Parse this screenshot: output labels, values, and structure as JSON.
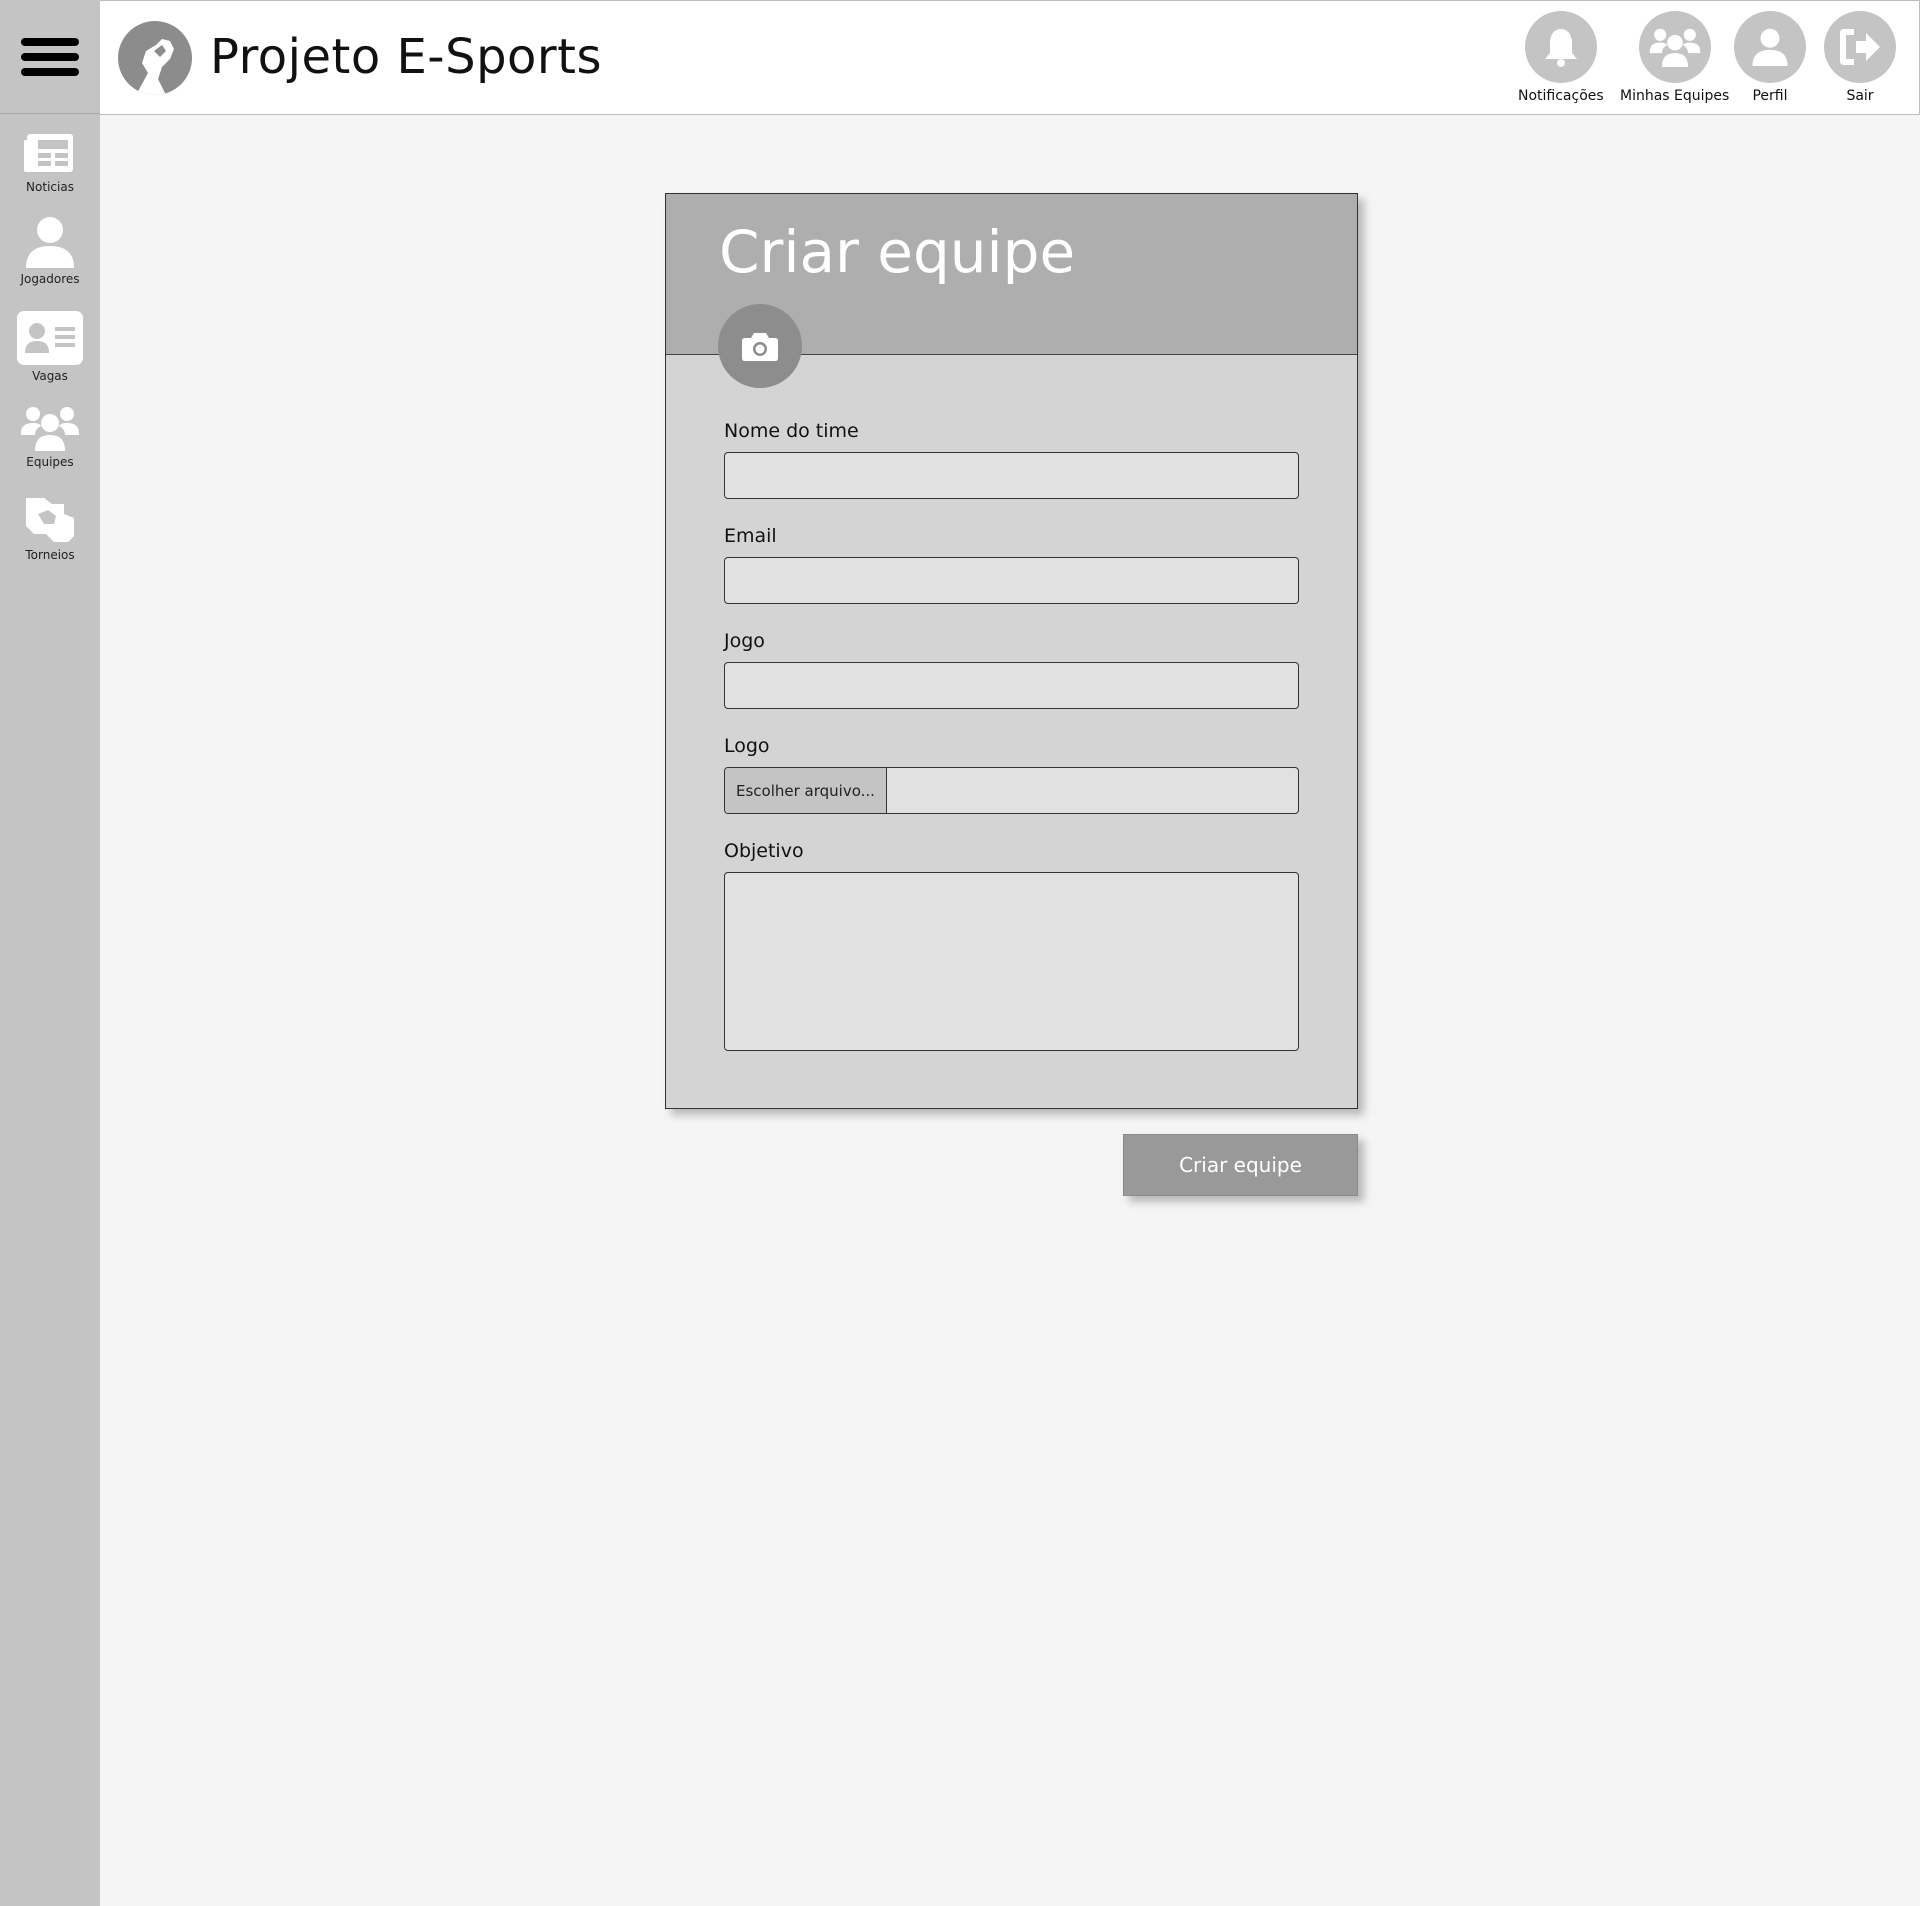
{
  "app": {
    "title": "Projeto E-Sports"
  },
  "topnav": [
    {
      "label": "Notificações",
      "icon": "bell-icon"
    },
    {
      "label": "Minhas Equipes",
      "icon": "users-icon"
    },
    {
      "label": "Perfil",
      "icon": "user-icon"
    },
    {
      "label": "Sair",
      "icon": "logout-icon"
    }
  ],
  "sidebar": [
    {
      "label": "Noticias",
      "icon": "newspaper-icon"
    },
    {
      "label": "Jogadores",
      "icon": "user-icon"
    },
    {
      "label": "Vagas",
      "icon": "id-card-icon"
    },
    {
      "label": "Equipes",
      "icon": "users-icon"
    },
    {
      "label": "Torneios",
      "icon": "handshake-icon"
    }
  ],
  "form": {
    "title": "Criar equipe",
    "fields": {
      "team_name": {
        "label": "Nome do time",
        "value": ""
      },
      "email": {
        "label": "Email",
        "value": ""
      },
      "game": {
        "label": "Jogo",
        "value": ""
      },
      "logo": {
        "label": "Logo",
        "button": "Escolher arquivo..."
      },
      "objective": {
        "label": "Objetivo",
        "value": ""
      }
    },
    "submit": "Criar equipe"
  },
  "colors": {
    "sidebar": "#c4c4c4",
    "card": "#d4d4d4",
    "card_header": "#aeaeae",
    "button": "#999999"
  }
}
